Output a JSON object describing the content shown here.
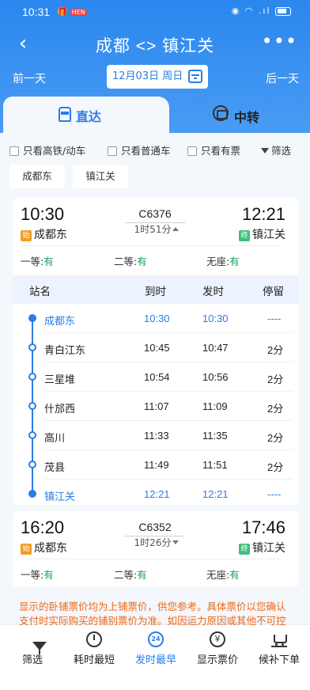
{
  "status_bar": {
    "time": "10:31",
    "notif_badge": "HEN"
  },
  "nav": {
    "back": "‹",
    "title": "成都 <> 镇江关",
    "more": "•••"
  },
  "date_bar": {
    "prev_label": "前一天",
    "date_label": "12月03日 周日",
    "next_label": "后一天"
  },
  "tabs": [
    {
      "label": "直达",
      "active": true,
      "icon": "train-icon"
    },
    {
      "label": "中转",
      "active": false,
      "icon": "transfer-icon"
    }
  ],
  "filters": {
    "high_speed": "只看高铁/动车",
    "normal": "只看普通车",
    "available": "只看有票",
    "filter_label": "筛选"
  },
  "station_chips": [
    "成都东",
    "镇江关"
  ],
  "trains": [
    {
      "dep_time": "10:30",
      "dep_badge": "始",
      "dep_station": "成都东",
      "train_no": "C6376",
      "duration": "1时51分",
      "arr_time": "12:21",
      "arr_badge": "终",
      "arr_station": "镇江关",
      "seats": [
        {
          "label": "一等:",
          "value": "有"
        },
        {
          "label": "二等:",
          "value": "有"
        },
        {
          "label": "无座:",
          "value": "有"
        }
      ],
      "expanded": true,
      "stops_header": {
        "station": "站名",
        "arrive": "到时",
        "depart": "发时",
        "stay": "停留"
      },
      "stops": [
        {
          "name": "成都东",
          "arrive": "10:30",
          "depart": "10:30",
          "stay": "----"
        },
        {
          "name": "青白江东",
          "arrive": "10:45",
          "depart": "10:47",
          "stay": "2分"
        },
        {
          "name": "三星堆",
          "arrive": "10:54",
          "depart": "10:56",
          "stay": "2分"
        },
        {
          "name": "什邡西",
          "arrive": "11:07",
          "depart": "11:09",
          "stay": "2分"
        },
        {
          "name": "高川",
          "arrive": "11:33",
          "depart": "11:35",
          "stay": "2分"
        },
        {
          "name": "茂县",
          "arrive": "11:49",
          "depart": "11:51",
          "stay": "2分"
        },
        {
          "name": "镇江关",
          "arrive": "12:21",
          "depart": "12:21",
          "stay": "----"
        }
      ]
    },
    {
      "dep_time": "16:20",
      "dep_badge": "始",
      "dep_station": "成都东",
      "train_no": "C6352",
      "duration": "1时26分",
      "arr_time": "17:46",
      "arr_badge": "终",
      "arr_station": "镇江关",
      "seats": [
        {
          "label": "一等:",
          "value": "有"
        },
        {
          "label": "二等:",
          "value": "有"
        },
        {
          "label": "无座:",
          "value": "有"
        }
      ],
      "expanded": false
    }
  ],
  "notice": "显示的卧铺票价均为上铺票价，供您参考。具体票价以您确认支付时实际购买的铺别票价为准。如因运力原因或其他不可控",
  "bottom_bar": [
    {
      "label": "筛选",
      "icon": "filter-icon"
    },
    {
      "label": "耗时最短",
      "icon": "clock-icon"
    },
    {
      "label": "发时最早",
      "icon": "24h-icon",
      "icon_text": "24",
      "active": true
    },
    {
      "label": "显示票价",
      "icon": "yen-icon",
      "icon_text": "¥"
    },
    {
      "label": "候补下单",
      "icon": "cart-icon"
    }
  ],
  "colors": {
    "primary": "#2a7de8",
    "available": "#1aa05a",
    "notice": "#ee6a1a",
    "start_badge": "#f39c1f",
    "end_badge": "#3cc17a"
  }
}
